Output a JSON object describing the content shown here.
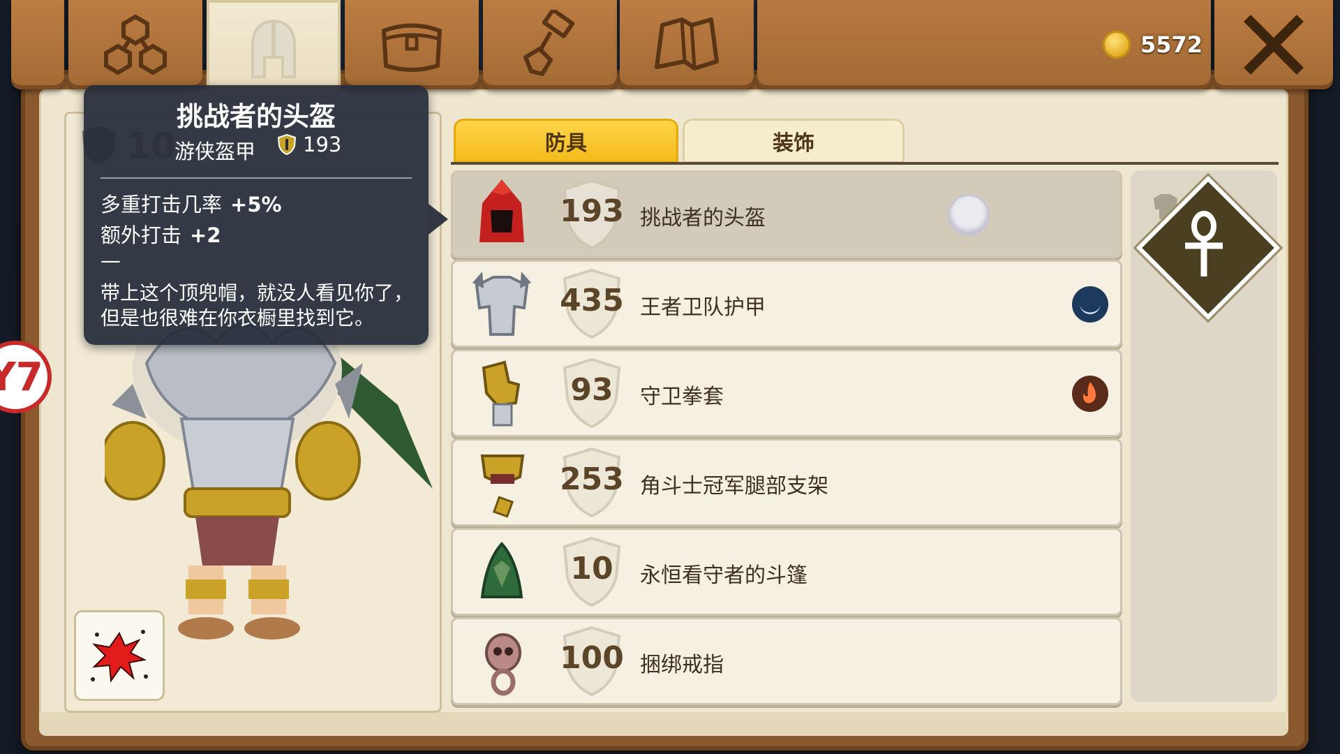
{
  "currency": {
    "amount": "5572"
  },
  "nav_tabs": [
    {
      "id": "hierarchy",
      "icon": "hierarchy-icon"
    },
    {
      "id": "equipment",
      "icon": "helmet-icon",
      "active": true
    },
    {
      "id": "inventory",
      "icon": "chest-icon"
    },
    {
      "id": "crafting",
      "icon": "hammer-icon"
    },
    {
      "id": "map",
      "icon": "map-icon"
    }
  ],
  "character": {
    "armor_value_partial": "10",
    "badge": "Y7"
  },
  "tooltip": {
    "title": "挑战者的头盔",
    "subtitle": "游侠盔甲",
    "armor": "193",
    "stats": [
      {
        "label": "多重打击几率",
        "value": "+5%"
      },
      {
        "label": "额外打击",
        "value": "+2"
      }
    ],
    "dash": "—",
    "description": "带上这个顶兜帽，就没人看见你了，但是也很难在你衣橱里找到它。"
  },
  "category_tabs": {
    "armor": "防具",
    "decoration": "装饰"
  },
  "items": [
    {
      "power": "193",
      "name": "挑战者的头盔",
      "icon": "red-hood-icon",
      "mark": "selected-marker",
      "mark_color": "#eceaf0"
    },
    {
      "power": "435",
      "name": "王者卫队护甲",
      "icon": "royal-armor-icon",
      "mark": "soul-enchant-icon",
      "mark_color": "#1d3a5c"
    },
    {
      "power": "93",
      "name": "守卫拳套",
      "icon": "gauntlet-icon",
      "mark": "fire-enchant-icon",
      "mark_color": "#5a2a1a"
    },
    {
      "power": "253",
      "name": "角斗士冠军腿部支架",
      "icon": "leg-brace-icon",
      "mark": "",
      "mark_color": ""
    },
    {
      "power": "10",
      "name": "永恒看守者的斗篷",
      "icon": "cloak-icon",
      "mark": "",
      "mark_color": ""
    },
    {
      "power": "100",
      "name": "捆绑戒指",
      "icon": "skull-ring-icon",
      "mark": "",
      "mark_color": ""
    }
  ],
  "colors": {
    "wood": "#a36a35",
    "paper": "#efe6cf",
    "tab_active": "#f3b918",
    "tooltip_bg": "#262c3a"
  }
}
